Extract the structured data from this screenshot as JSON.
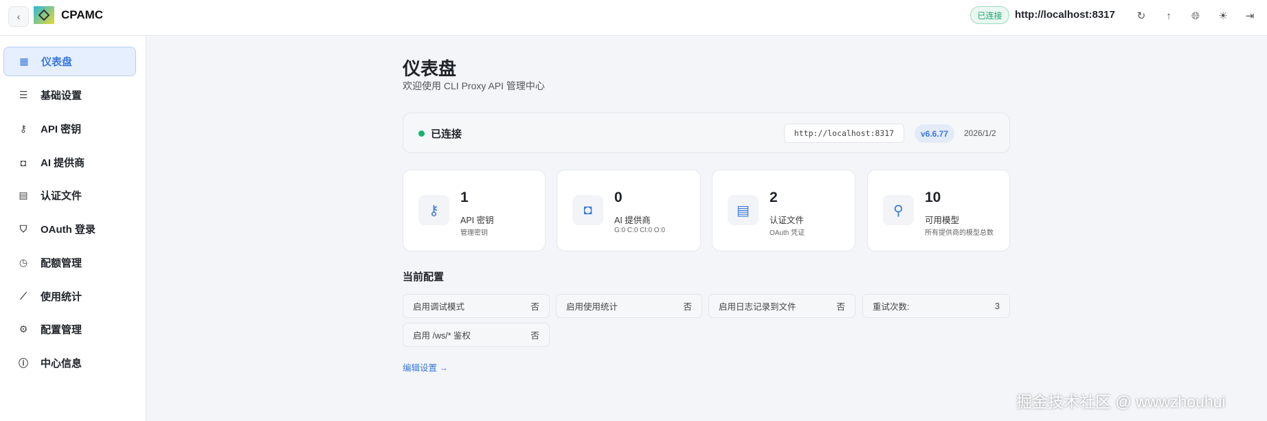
{
  "header": {
    "brand": "CPAMC",
    "status_badge": "已连接",
    "url": "http://localhost:8317"
  },
  "sidebar": {
    "items": [
      {
        "label": "仪表盘",
        "icon": "dashboard-icon",
        "glyph": "▦"
      },
      {
        "label": "基础设置",
        "icon": "sliders-icon",
        "glyph": "☰"
      },
      {
        "label": "API 密钥",
        "icon": "key-icon",
        "glyph": "⚷"
      },
      {
        "label": "AI 提供商",
        "icon": "bot-icon",
        "glyph": "◘"
      },
      {
        "label": "认证文件",
        "icon": "file-icon",
        "glyph": "▤"
      },
      {
        "label": "OAuth 登录",
        "icon": "shield-icon",
        "glyph": "⛉"
      },
      {
        "label": "配额管理",
        "icon": "timer-icon",
        "glyph": "◷"
      },
      {
        "label": "使用统计",
        "icon": "chart-icon",
        "glyph": "⟋"
      },
      {
        "label": "配置管理",
        "icon": "gear-icon",
        "glyph": "⚙"
      },
      {
        "label": "中心信息",
        "icon": "info-icon",
        "glyph": "ⓘ"
      }
    ]
  },
  "main": {
    "title": "仪表盘",
    "subtitle": "欢迎使用 CLI Proxy API 管理中心",
    "status": {
      "text": "已连接",
      "url": "http://localhost:8317",
      "version": "v6.6.77",
      "date": "2026/1/2"
    },
    "cards": [
      {
        "value": "1",
        "label": "API 密钥",
        "sub": "管理密钥",
        "glyph": "⚷"
      },
      {
        "value": "0",
        "label": "AI 提供商",
        "sub": "G:0 C:0 Cl:0 O:0",
        "glyph": "◘"
      },
      {
        "value": "2",
        "label": "认证文件",
        "sub": "OAuth 凭证",
        "glyph": "▤"
      },
      {
        "value": "10",
        "label": "可用模型",
        "sub": "所有提供商的模型总数",
        "glyph": "⚲"
      }
    ],
    "config_title": "当前配置",
    "config": [
      {
        "label": "启用调试模式",
        "value": "否"
      },
      {
        "label": "启用使用统计",
        "value": "否"
      },
      {
        "label": "启用日志记录到文件",
        "value": "否"
      },
      {
        "label": "重试次数:",
        "value": "3"
      },
      {
        "label": "启用 /ws/* 鉴权",
        "value": "否"
      }
    ],
    "edit_link": "编辑设置 →"
  },
  "watermark": "掘金技术社区 @ wwwzhouhui"
}
